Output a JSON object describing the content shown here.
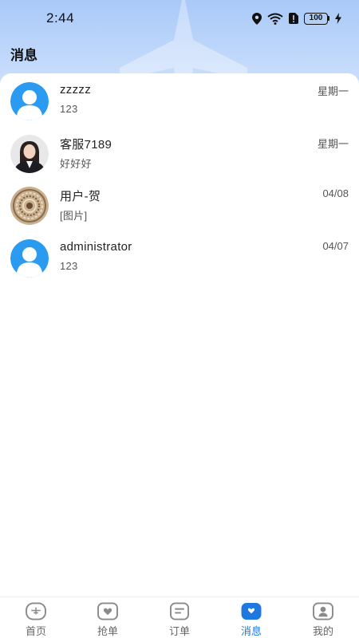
{
  "status_bar": {
    "time": "2:44",
    "battery": "100"
  },
  "page": {
    "title": "消息"
  },
  "conversations": [
    {
      "name": "zzzzz",
      "preview": "123",
      "time": "星期一",
      "avatar": "default-user-icon"
    },
    {
      "name": "客服7189",
      "preview": "好好好",
      "time": "星期一",
      "avatar": "photo-woman"
    },
    {
      "name": "用户-贺",
      "preview": "[图片]",
      "time": "04/08",
      "avatar": "photo-pattern"
    },
    {
      "name": "administrator",
      "preview": "123",
      "time": "04/07",
      "avatar": "default-user-icon"
    }
  ],
  "tabs": [
    {
      "label": "首页",
      "icon": "home-icon",
      "active": false
    },
    {
      "label": "抢单",
      "icon": "grab-order-icon",
      "active": false
    },
    {
      "label": "订单",
      "icon": "order-list-icon",
      "active": false
    },
    {
      "label": "消息",
      "icon": "message-icon",
      "active": true
    },
    {
      "label": "我的",
      "icon": "profile-icon",
      "active": false
    }
  ],
  "colors": {
    "accent": "#1e78e0",
    "header_gradient_top": "#a9c9f7",
    "default_avatar": "#2a9bf0"
  }
}
